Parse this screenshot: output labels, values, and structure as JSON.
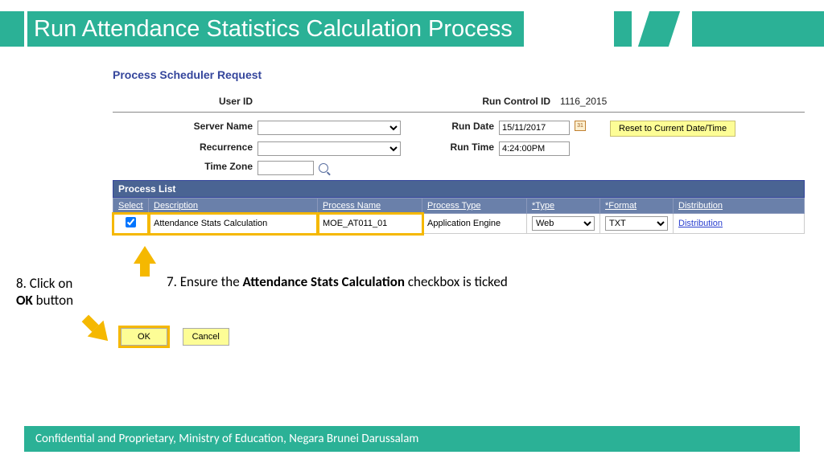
{
  "header": {
    "title": "Run Attendance Statistics Calculation Process"
  },
  "section_title": "Process Scheduler Request",
  "form": {
    "user_id_label": "User ID",
    "run_control_id_label": "Run Control ID",
    "run_control_id_value": "1116_2015",
    "server_name_label": "Server Name",
    "recurrence_label": "Recurrence",
    "time_zone_label": "Time Zone",
    "run_date_label": "Run Date",
    "run_date_value": "15/11/2017",
    "run_time_label": "Run Time",
    "run_time_value": "4:24:00PM",
    "reset_btn": "Reset to Current Date/Time"
  },
  "process_list": {
    "header": "Process List",
    "cols": {
      "select": "Select",
      "description": "Description",
      "process_name": "Process Name",
      "process_type": "Process Type",
      "type": "*Type",
      "format": "*Format",
      "distribution": "Distribution"
    },
    "row": {
      "description": "Attendance Stats Calculation",
      "process_name": "MOE_AT011_01",
      "process_type": "Application Engine",
      "type": "Web",
      "format": "TXT",
      "distribution": "Distribution"
    }
  },
  "buttons": {
    "ok": "OK",
    "cancel": "Cancel"
  },
  "instructions": {
    "step7_prefix": "7. Ensure the ",
    "step7_bold": "Attendance Stats Calculation",
    "step7_suffix": " checkbox is ticked",
    "step8_line1": "8. Click on",
    "step8_bold": "OK",
    "step8_suffix": " button"
  },
  "footer": "Confidential and Proprietary, Ministry of Education, Negara Brunei Darussalam"
}
